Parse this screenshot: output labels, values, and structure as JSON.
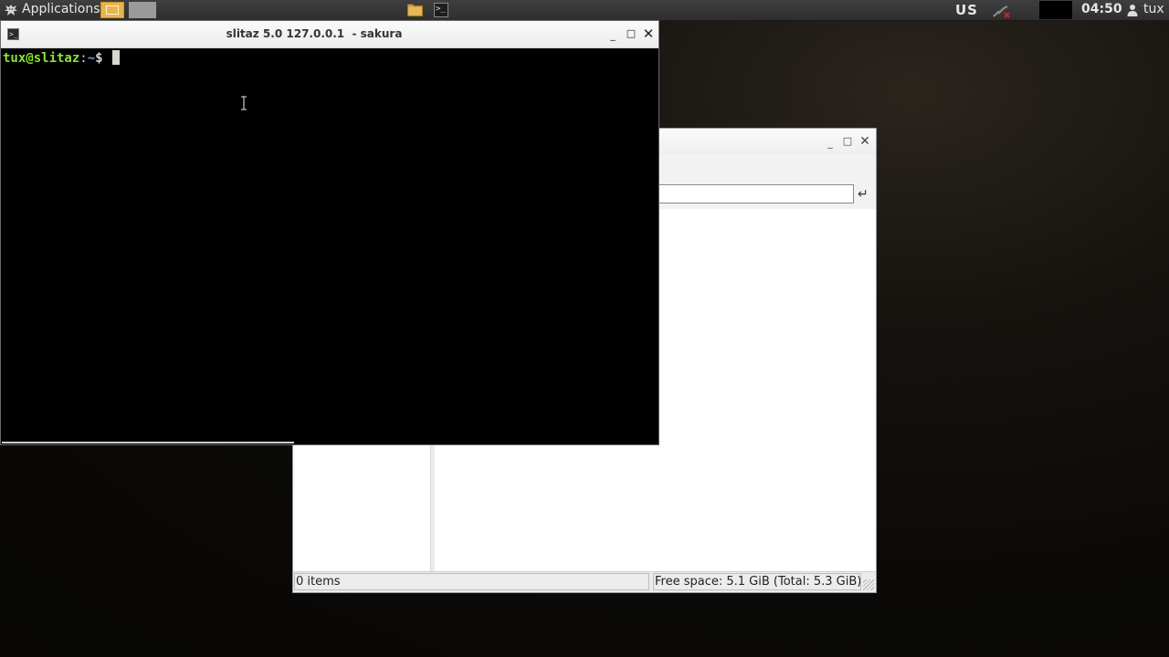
{
  "panel": {
    "applications_label": "Applications",
    "keyboard_layout": "US",
    "clock": "04:50",
    "user": "tux"
  },
  "terminal": {
    "title": "slitaz 5.0 127.0.0.1  - sakura",
    "prompt_user": "tux@slitaz",
    "prompt_colon": ":",
    "prompt_path": "~",
    "prompt_dollar": "$",
    "colors": {
      "user": "#8ae234",
      "path": "#729fcf",
      "background": "#000000"
    }
  },
  "file_manager": {
    "location_value": "",
    "status_items": "0 items",
    "status_free_space": "Free space: 5.1 GiB (Total: 5.3 GiB)"
  },
  "icons": [
    "slitaz-menu-icon",
    "folder-icon",
    "terminal-icon",
    "network-icon",
    "user-icon",
    "minimize-icon",
    "maximize-icon",
    "close-icon",
    "go-arrow-icon"
  ]
}
